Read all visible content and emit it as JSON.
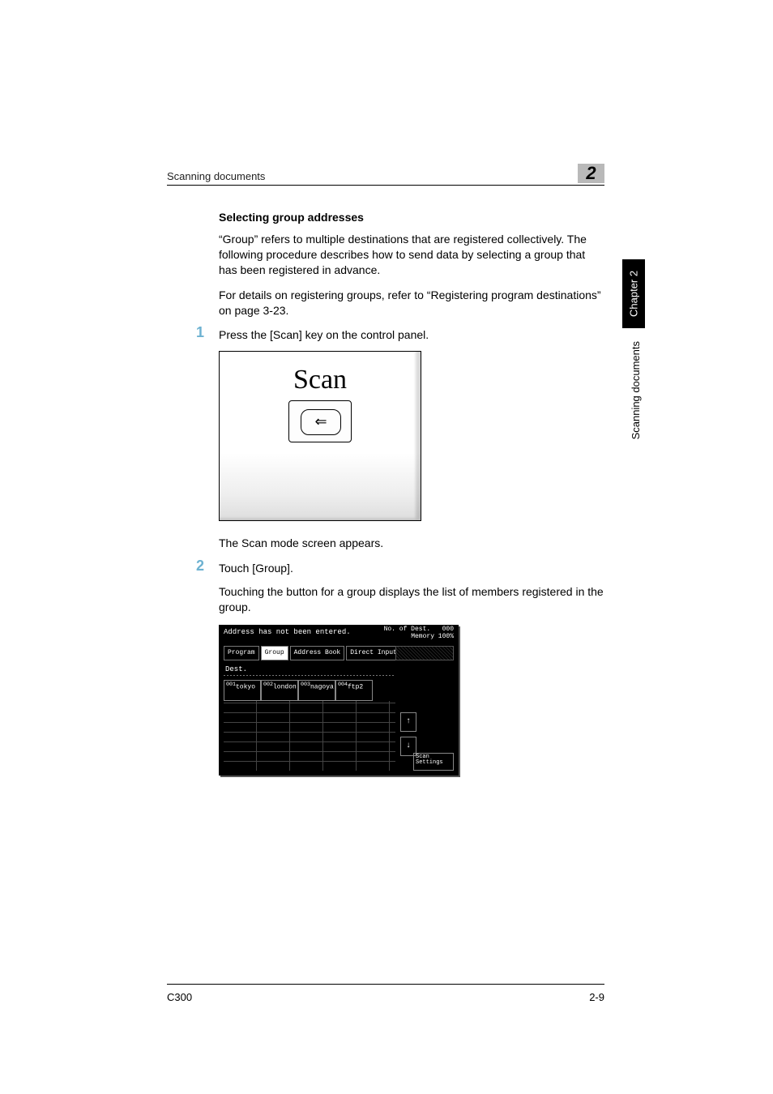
{
  "running_head": "Scanning documents",
  "chapter_badge": "2",
  "side_tab": "Chapter 2",
  "side_text": "Scanning documents",
  "heading": "Selecting group addresses",
  "para1": "“Group” refers to multiple destinations that are registered collectively. The following procedure describes how to send data by selecting a group that has been registered in advance.",
  "para2": "For details on registering groups, refer to “Registering program destinations” on page 3-23.",
  "steps": [
    {
      "num": "1",
      "text": "Press the [Scan] key on the control panel.",
      "after": "The Scan mode screen appears."
    },
    {
      "num": "2",
      "text": "Touch [Group].",
      "detail": "Touching the button for a group displays the list of members registered in the group."
    }
  ],
  "scan_panel_label": "Scan",
  "scan_arrow": "⇐",
  "screenshot": {
    "top": "Address has not been entered.",
    "dest_count_label": "No. of Dest.",
    "dest_count": "000",
    "memory": "Memory 100%",
    "tabs": [
      "Program",
      "Group",
      "Address Book",
      "Direct Input"
    ],
    "active_tab": 1,
    "dest_label": "Dest.",
    "groups": [
      "tokyo",
      "london",
      "nagoya",
      "ftp2"
    ],
    "group_prefixes": [
      "001",
      "002",
      "003",
      "004"
    ],
    "up": "↑",
    "down": "↓",
    "scan_settings": "Scan Settings"
  },
  "footer_left": "C300",
  "footer_right": "2-9"
}
